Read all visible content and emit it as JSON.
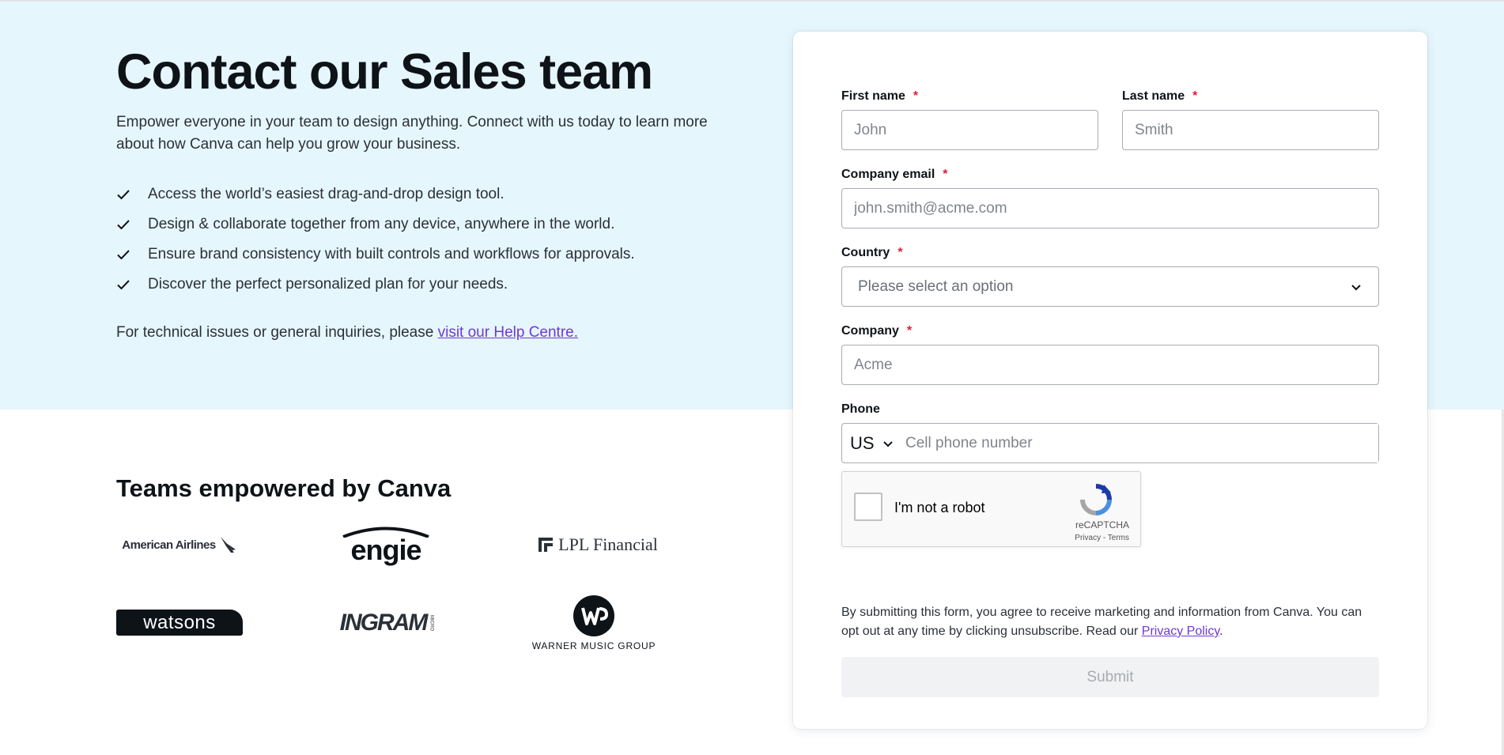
{
  "hero": {
    "title": "Contact our Sales team",
    "intro": "Empower everyone in your team to design anything. Connect with us today to learn more about how Canva can help you grow your business.",
    "features": [
      "Access the world’s easiest drag-and-drop design tool.",
      "Design & collaborate together from any device, anywhere in the world.",
      "Ensure brand consistency with built controls and workflows for approvals.",
      "Discover the perfect personalized plan for your needs."
    ],
    "help_prefix": "For technical issues or general inquiries, please ",
    "help_link": "visit our Help Centre."
  },
  "teams": {
    "title": "Teams empowered by Canva",
    "logos": [
      "American Airlines",
      "engie",
      "LPL Financial",
      "watsons",
      "INGRAM",
      "MICRO",
      "WARNER MUSIC GROUP"
    ]
  },
  "form": {
    "first_name_label": "First name",
    "first_name_placeholder": "John",
    "last_name_label": "Last name",
    "last_name_placeholder": "Smith",
    "email_label": "Company email",
    "email_placeholder": "john.smith@acme.com",
    "country_label": "Country",
    "country_placeholder": "Please select an option",
    "company_label": "Company",
    "company_placeholder": "Acme",
    "phone_label": "Phone",
    "phone_country": "US",
    "phone_placeholder": "Cell phone number",
    "required_marker": "*",
    "captcha_label": "I'm not a robot",
    "captcha_brand": "reCAPTCHA",
    "captcha_links": "Privacy - Terms",
    "consent_text": "By submitting this form, you agree to receive marketing and information from Canva. You can opt out at any time by clicking unsubscribe. Read our ",
    "consent_link": "Privacy Policy",
    "consent_end": ".",
    "submit_label": "Submit"
  },
  "colors": {
    "hero_bg": "#e6f6fd",
    "link": "#6d3ad6",
    "required": "#e01e37",
    "submit_bg": "#f1f2f4"
  }
}
